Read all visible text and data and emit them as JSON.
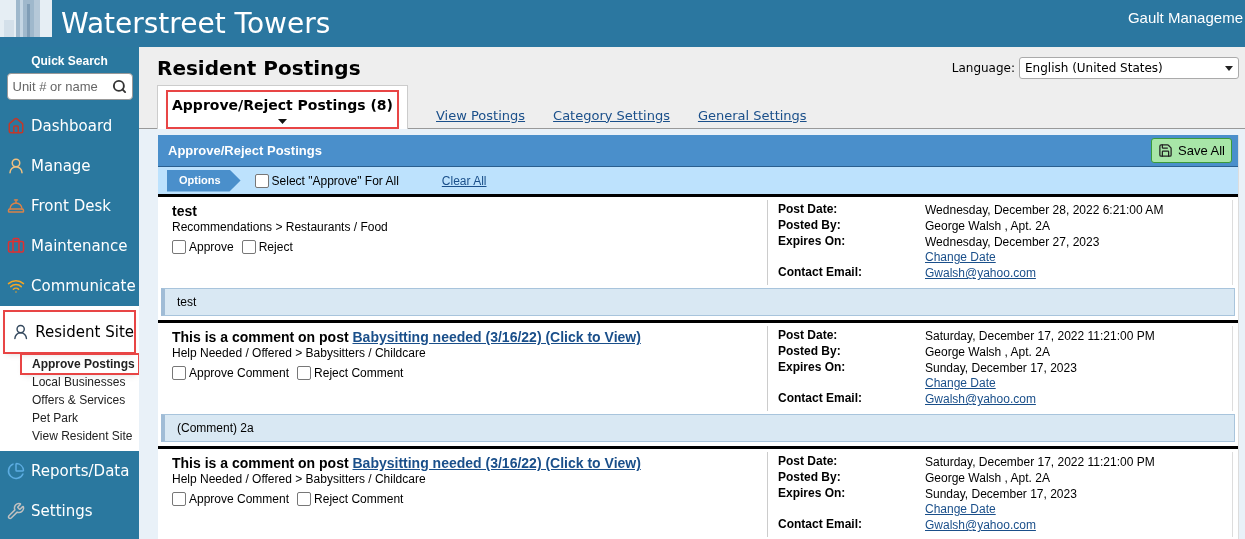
{
  "header": {
    "title": "Waterstreet Towers",
    "company": "Gault Manageme"
  },
  "quick_search": {
    "label": "Quick Search",
    "placeholder": "Unit # or name"
  },
  "sidebar": {
    "items": [
      {
        "label": "Dashboard",
        "selected": false,
        "highlighted": false
      },
      {
        "label": "Manage",
        "selected": false,
        "highlighted": false
      },
      {
        "label": "Front Desk",
        "selected": false,
        "highlighted": false
      },
      {
        "label": "Maintenance",
        "selected": false,
        "highlighted": false
      },
      {
        "label": "Communicate",
        "selected": false,
        "highlighted": false
      },
      {
        "label": "Resident Site",
        "selected": true,
        "highlighted": true,
        "children": [
          {
            "label": "Approve Postings",
            "selected": true,
            "highlighted": true
          },
          {
            "label": "Local Businesses",
            "selected": false,
            "highlighted": false
          },
          {
            "label": "Offers & Services",
            "selected": false,
            "highlighted": false
          },
          {
            "label": "Pet Park",
            "selected": false,
            "highlighted": false
          },
          {
            "label": "View Resident Site",
            "selected": false,
            "highlighted": false
          }
        ]
      },
      {
        "label": "Reports/Data",
        "selected": false,
        "highlighted": false
      },
      {
        "label": "Settings",
        "selected": false,
        "highlighted": false
      }
    ]
  },
  "page": {
    "title": "Resident Postings",
    "language_label": "Language:",
    "language_value": "English (United States)"
  },
  "tabs": [
    {
      "label": "Approve/Reject Postings (8)",
      "selected": true,
      "highlighted": true
    },
    {
      "label": "View Postings",
      "selected": false,
      "highlighted": false
    },
    {
      "label": "Category Settings",
      "selected": false,
      "highlighted": false
    },
    {
      "label": "General Settings",
      "selected": false,
      "highlighted": false
    }
  ],
  "panel": {
    "title": "Approve/Reject Postings",
    "save_button": "Save All",
    "options_label": "Options",
    "select_all": {
      "label": "Select \"Approve\" For All",
      "checked": false
    },
    "clear_all": "Clear All"
  },
  "postings": [
    {
      "title": "test",
      "category": "Recommendations > Restaurants / Food",
      "options": [
        {
          "label": "Approve",
          "checked": false
        },
        {
          "label": "Reject",
          "checked": false
        }
      ],
      "details": [
        {
          "label": "Post Date:",
          "value": "Wednesday, December 28, 2022 6:21:00 AM"
        },
        {
          "label": "Posted By:",
          "value": "George Walsh , Apt. 2A"
        },
        {
          "label": "Expires On:",
          "value": "Wednesday, December 27, 2023",
          "link": "Change Date"
        },
        {
          "label": "Contact Email:",
          "link": "Gwalsh@yahoo.com"
        }
      ],
      "message": "test"
    },
    {
      "title": "This is a comment on post",
      "title_link": "Babysitting needed (3/16/22) (Click to View)",
      "category": "Help Needed / Offered > Babysitters / Childcare",
      "options": [
        {
          "label": "Approve Comment",
          "checked": false
        },
        {
          "label": "Reject Comment",
          "checked": false
        }
      ],
      "details": [
        {
          "label": "Post Date:",
          "value": "Saturday, December 17, 2022 11:21:00 PM"
        },
        {
          "label": "Posted By:",
          "value": "George Walsh , Apt. 2A"
        },
        {
          "label": "Expires On:",
          "value": "Sunday, December 17, 2023",
          "link": "Change Date"
        },
        {
          "label": "Contact Email:",
          "link": "Gwalsh@yahoo.com"
        }
      ],
      "message": "(Comment) 2a"
    },
    {
      "title": "This is a comment on post",
      "title_link": "Babysitting needed (3/16/22) (Click to View)",
      "category": "Help Needed / Offered > Babysitters / Childcare",
      "options": [
        {
          "label": "Approve Comment",
          "checked": false
        },
        {
          "label": "Reject Comment",
          "checked": false
        }
      ],
      "details": [
        {
          "label": "Post Date:",
          "value": "Saturday, December 17, 2022 11:21:00 PM"
        },
        {
          "label": "Posted By:",
          "value": "George Walsh , Apt. 2A"
        },
        {
          "label": "Expires On:",
          "value": "Sunday, December 17, 2023",
          "link": "Change Date"
        },
        {
          "label": "Contact Email:",
          "link": "Gwalsh@yahoo.com"
        }
      ]
    }
  ]
}
